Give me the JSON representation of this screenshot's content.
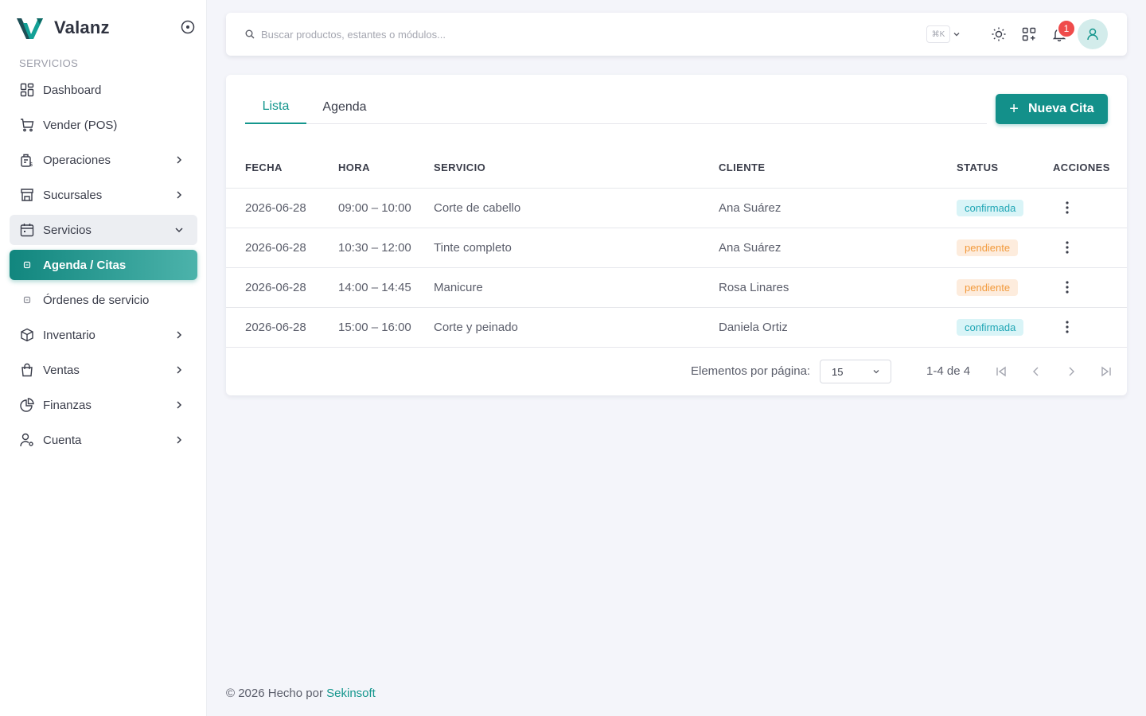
{
  "brand": {
    "name": "Valanz"
  },
  "sidebar": {
    "section_label": "SERVICIOS",
    "items": [
      {
        "label": "Dashboard",
        "icon": "dashboard-icon"
      },
      {
        "label": "Vender (POS)",
        "icon": "cart-icon"
      },
      {
        "label": "Operaciones",
        "icon": "operations-icon"
      },
      {
        "label": "Sucursales",
        "icon": "store-icon"
      },
      {
        "label": "Servicios",
        "icon": "calendar-icon"
      },
      {
        "label": "Agenda / Citas",
        "icon": "dot-icon"
      },
      {
        "label": "Órdenes de servicio",
        "icon": "dot-icon"
      },
      {
        "label": "Inventario",
        "icon": "box-icon"
      },
      {
        "label": "Ventas",
        "icon": "bag-icon"
      },
      {
        "label": "Finanzas",
        "icon": "pie-chart-icon"
      },
      {
        "label": "Cuenta",
        "icon": "user-settings-icon"
      }
    ]
  },
  "topbar": {
    "search_placeholder": "Buscar productos, estantes o módulos...",
    "shortcut": "⌘K",
    "notification_count": "1"
  },
  "tabs": [
    {
      "label": "Lista"
    },
    {
      "label": "Agenda"
    }
  ],
  "new_button_label": "Nueva Cita",
  "table": {
    "headers": [
      "FECHA",
      "HORA",
      "SERVICIO",
      "CLIENTE",
      "STATUS",
      "ACCIONES"
    ],
    "rows": [
      {
        "fecha": "2026-06-28",
        "hora": "09:00 – 10:00",
        "servicio": "Corte de cabello",
        "cliente": "Ana Suárez",
        "status": "confirmada"
      },
      {
        "fecha": "2026-06-28",
        "hora": "10:30 – 12:00",
        "servicio": "Tinte completo",
        "cliente": "Ana Suárez",
        "status": "pendiente"
      },
      {
        "fecha": "2026-06-28",
        "hora": "14:00 – 14:45",
        "servicio": "Manicure",
        "cliente": "Rosa Linares",
        "status": "pendiente"
      },
      {
        "fecha": "2026-06-28",
        "hora": "15:00 – 16:00",
        "servicio": "Corte y peinado",
        "cliente": "Daniela Ortiz",
        "status": "confirmada"
      }
    ]
  },
  "pagination": {
    "label": "Elementos por página:",
    "page_size": "15",
    "range": "1-4 de 4"
  },
  "footer": {
    "text": "© 2026 Hecho por",
    "link": "Sekinsoft"
  },
  "colors": {
    "accent": "#14968d",
    "confirmed_bg": "#d9f4f7",
    "pending_bg": "#fdecdd"
  }
}
